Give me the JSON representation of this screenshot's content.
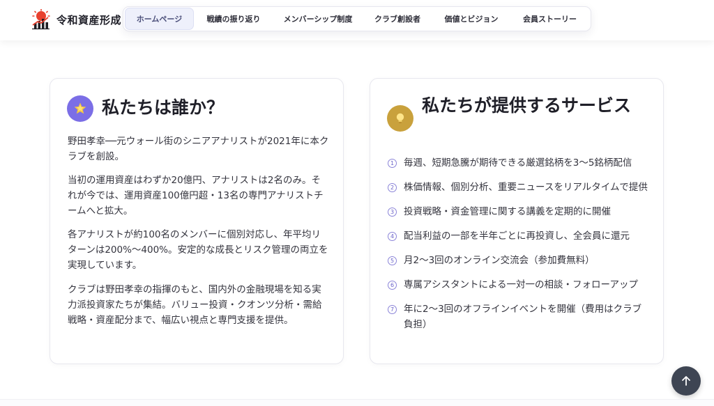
{
  "header": {
    "brand_name": "令和資産形成",
    "logo_icon": "chart-sun-logo-icon",
    "nav": [
      {
        "label": "ホームページ",
        "active": true
      },
      {
        "label": "戦績の振り返り"
      },
      {
        "label": "メンバーシップ制度"
      },
      {
        "label": "クラブ創設者"
      },
      {
        "label": "価値とビジョン"
      },
      {
        "label": "会員ストーリー"
      }
    ]
  },
  "about": {
    "icon": "star-icon",
    "icon_color": "#7b6ee6",
    "title": "私たちは誰か？",
    "paragraphs": [
      "野田孝幸──元ウォール街のシニアアナリストが2021年に本クラブを創設。",
      "当初の運用資産はわずか20億円、アナリストは2名のみ。それが今では、運用資産100億円超・13名の専門アナリストチームへと拡大。",
      "各アナリストが約100名のメンバーに個別対応し、年平均リターンは200%〜400%。安定的な成長とリスク管理の両立を実現しています。",
      "クラブは野田孝幸の指揮のもと、国内外の金融現場を知る実力派投資家たちが集結。バリュー投資・クオンツ分析・需給戦略・資産配分まで、幅広い視点と専門支援を提供。"
    ]
  },
  "services": {
    "icon": "lightbulb-icon",
    "icon_color": "#c9a13c",
    "title": "私たちが提供するサービス",
    "items": [
      {
        "num": "1",
        "text": "毎週、短期急騰が期待できる厳選銘柄を3〜5銘柄配信"
      },
      {
        "num": "2",
        "text": "株価情報、個別分析、重要ニュースをリアルタイムで提供"
      },
      {
        "num": "3",
        "text": "投資戦略・資金管理に関する講義を定期的に開催"
      },
      {
        "num": "4",
        "text": "配当利益の一部を半年ごとに再投資し、全会員に還元"
      },
      {
        "num": "5",
        "text": "月2〜3回のオンライン交流会（参加費無料）"
      },
      {
        "num": "6",
        "text": "専属アシスタントによる一対一の相談・フォローアップ"
      },
      {
        "num": "7",
        "text": "年に2〜3回のオフラインイベントを開催（費用はクラブ負担）"
      }
    ]
  },
  "scroll_top": {
    "icon": "arrow-up-icon"
  }
}
